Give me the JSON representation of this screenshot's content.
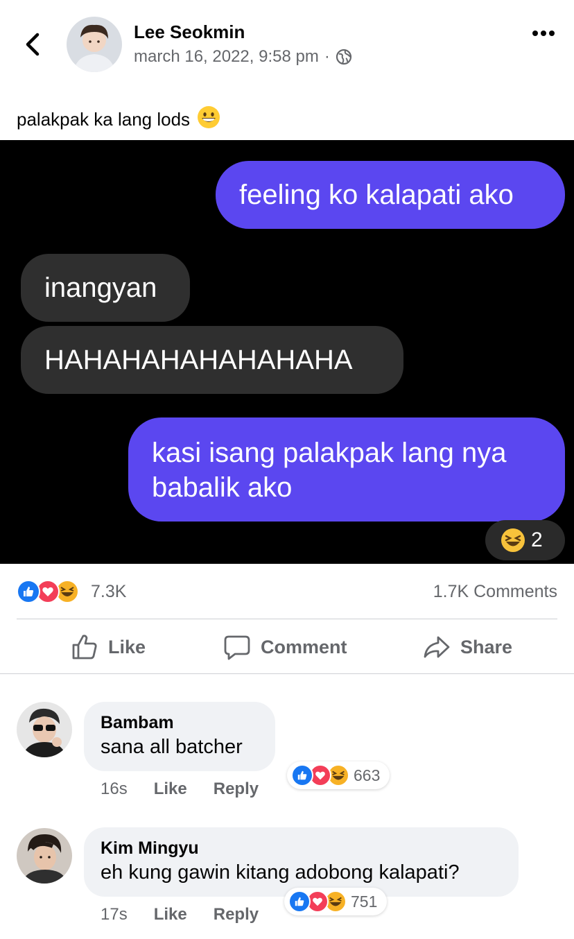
{
  "post": {
    "author": "Lee Seokmin",
    "timestamp": "march 16, 2022, 9:58 pm",
    "separator": "·",
    "privacy_icon": "globe-icon",
    "caption": "palakpak ka lang lods",
    "caption_emoji": "grinning-face-icon"
  },
  "image": {
    "messages": [
      {
        "side": "sent",
        "text": "feeling ko kalapati ako"
      },
      {
        "side": "received",
        "text": "inangyan"
      },
      {
        "side": "received",
        "text": "HAHAHAHAHAHAHAHA"
      },
      {
        "side": "sent",
        "text": "kasi isang palakpak lang nya babalik ako"
      }
    ],
    "message_reaction_count": "2",
    "colors": {
      "sent_bubble": "#5b47f0",
      "received_bubble": "#2f2f2f",
      "background": "#000000"
    }
  },
  "stats": {
    "reaction_count": "7.3K",
    "comments_count": "1.7K Comments"
  },
  "actions": {
    "like": "Like",
    "comment": "Comment",
    "share": "Share"
  },
  "comments": [
    {
      "name": "Bambam",
      "text": "sana all batcher",
      "time": "16s",
      "like": "Like",
      "reply": "Reply",
      "reaction_count": "663"
    },
    {
      "name": "Kim Mingyu",
      "text": "eh kung gawin kitang adobong kalapati?",
      "time": "17s",
      "like": "Like",
      "reply": "Reply",
      "reaction_count": "751"
    }
  ],
  "colors": {
    "like_blue": "#1877f2",
    "love_red": "#f33e58",
    "haha_yellow": "#f7b125",
    "secondary_text": "#65676b"
  }
}
